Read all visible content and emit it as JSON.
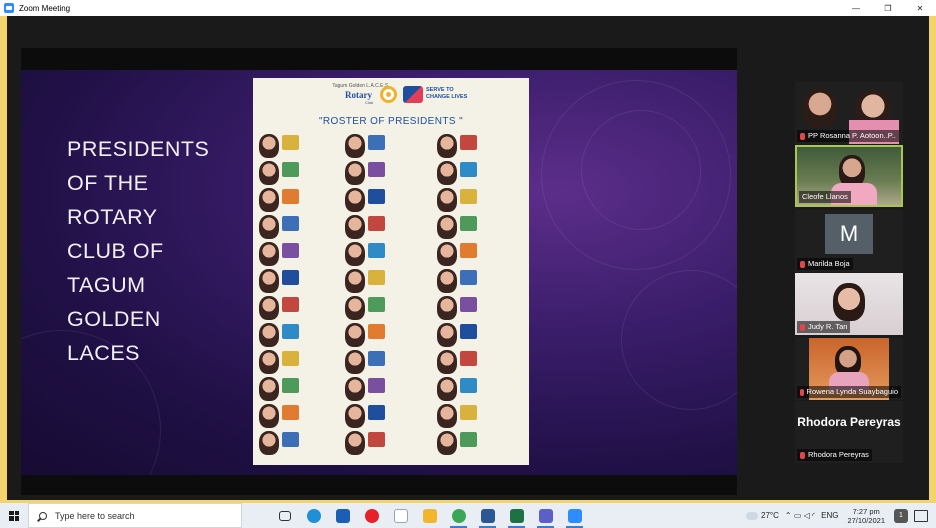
{
  "window": {
    "title": "Zoom Meeting"
  },
  "window_controls": [
    "—",
    "❐",
    "✕"
  ],
  "slide": {
    "heading_lines": [
      "PRESIDENTS",
      "OF THE",
      "ROTARY",
      "CLUB OF",
      "TAGUM",
      "GOLDEN",
      "LACES"
    ],
    "poster": {
      "club": "Tagum Golden L.A.C.E.S.",
      "rotary": "Rotary",
      "club_word": "Club",
      "serve_line1": "SERVE TO",
      "serve_line2": "CHANGE LIVES",
      "heading": "\"ROSTER OF PRESIDENTS \""
    }
  },
  "participants": [
    {
      "name": "PP Rosanna P. Aotoon..P..",
      "muted": true,
      "kind": "video-two"
    },
    {
      "name": "Cleofe Llanos",
      "muted": false,
      "kind": "video-active"
    },
    {
      "name": "Marilda Boja",
      "muted": true,
      "kind": "avatar",
      "initial": "M"
    },
    {
      "name": "Judy R. Tan",
      "muted": true,
      "kind": "video"
    },
    {
      "name": "Rowena Lynda Suaybaguio",
      "muted": true,
      "kind": "video"
    },
    {
      "name": "Rhodora Pereyras",
      "muted": true,
      "kind": "name-only",
      "display_text": "Rhodora Pereyras"
    }
  ],
  "taskbar": {
    "search_placeholder": "Type here to search",
    "apps": [
      {
        "icon": "task-view-icon",
        "color": "#333333",
        "running": false
      },
      {
        "icon": "edge-icon",
        "color": "#1f8fd6",
        "running": false
      },
      {
        "icon": "mail-icon",
        "color": "#1b5fb5",
        "running": false
      },
      {
        "icon": "opera-icon",
        "color": "#e8202a",
        "running": false
      },
      {
        "icon": "file-icon",
        "color": "#ffffff",
        "running": false
      },
      {
        "icon": "file-explorer-icon",
        "color": "#f2b62d",
        "running": false
      },
      {
        "icon": "chrome-icon",
        "color": "#3aa757",
        "running": true
      },
      {
        "icon": "word-icon",
        "color": "#2b5797",
        "running": true
      },
      {
        "icon": "excel-icon",
        "color": "#1e7145",
        "running": true
      },
      {
        "icon": "teams-icon",
        "color": "#5b5fc7",
        "running": true
      },
      {
        "icon": "zoom-icon",
        "color": "#2d8cff",
        "running": true
      }
    ],
    "weather": "27°C",
    "language": "ENG",
    "time": "7:27 pm",
    "date": "27/10/2021",
    "notification_count": "1"
  }
}
